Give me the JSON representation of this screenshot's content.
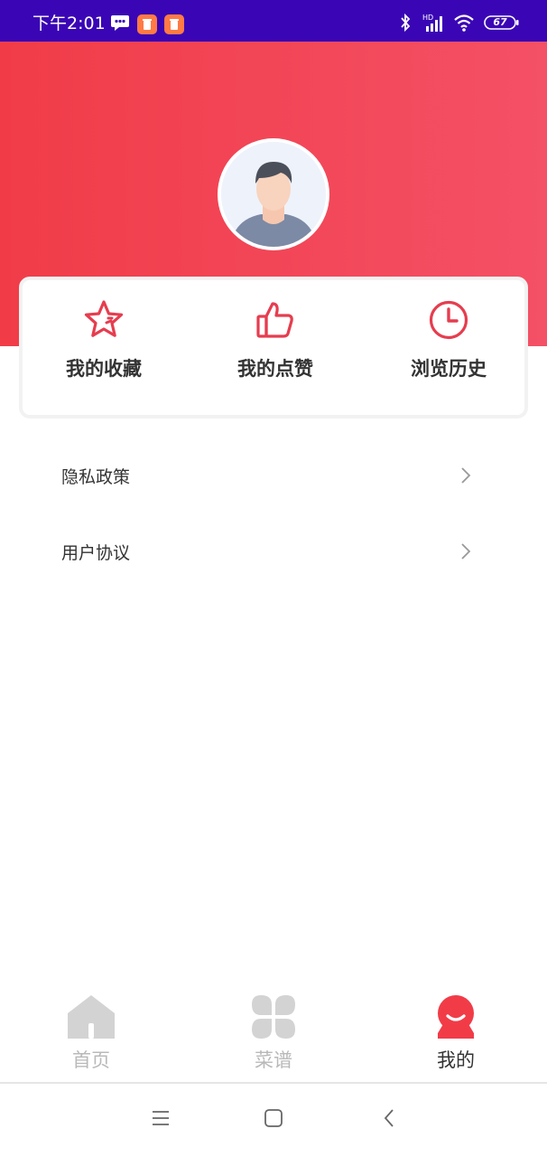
{
  "status_bar": {
    "time": "下午2:01",
    "battery": "67",
    "network_label": "HD"
  },
  "quick_actions": [
    {
      "label": "我的收藏",
      "icon": "star-icon"
    },
    {
      "label": "我的点赞",
      "icon": "thumbs-up-icon"
    },
    {
      "label": "浏览历史",
      "icon": "clock-icon"
    }
  ],
  "menu": [
    {
      "label": "隐私政策"
    },
    {
      "label": "用户协议"
    }
  ],
  "tabs": [
    {
      "label": "首页",
      "icon": "home-icon",
      "active": false
    },
    {
      "label": "菜谱",
      "icon": "grid-icon",
      "active": false
    },
    {
      "label": "我的",
      "icon": "profile-icon",
      "active": true
    }
  ],
  "colors": {
    "accent": "#f13c48",
    "status_bar": "#3a06b5",
    "tab_inactive": "#b9b9b9"
  }
}
